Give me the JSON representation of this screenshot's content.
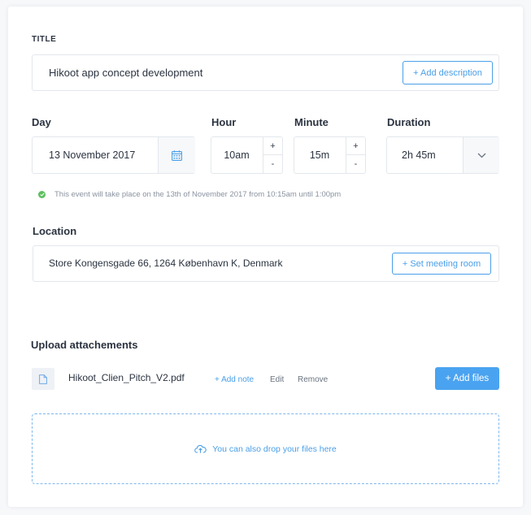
{
  "title_section": {
    "label": "TITLE",
    "value": "Hikoot app concept development",
    "add_description_label": "+ Add description"
  },
  "schedule": {
    "day_label": "Day",
    "day_value": "13 November 2017",
    "hour_label": "Hour",
    "hour_value": "10am",
    "minute_label": "Minute",
    "minute_value": "15m",
    "duration_label": "Duration",
    "duration_value": "2h 45m",
    "stepper_plus": "+",
    "stepper_minus": "-",
    "info_text": "This event will take place on the 13th of November 2017 from 10:15am until 1:00pm"
  },
  "location": {
    "label": "Location",
    "value": "Store Kongensgade 66, 1264 København K, Denmark",
    "set_room_label": "+ Set meeting room"
  },
  "attachments": {
    "label": "Upload attachements",
    "files": [
      {
        "name": "Hikoot_Clien_Pitch_V2.pdf",
        "add_note": "+ Add note",
        "edit": "Edit",
        "remove": "Remove"
      }
    ],
    "add_files_label": "+ Add files",
    "drop_text": "You can also drop your files here"
  },
  "colors": {
    "accent": "#4a9fe8",
    "success": "#5cbf5e",
    "text": "#2b3340",
    "muted": "#8a93a0"
  }
}
